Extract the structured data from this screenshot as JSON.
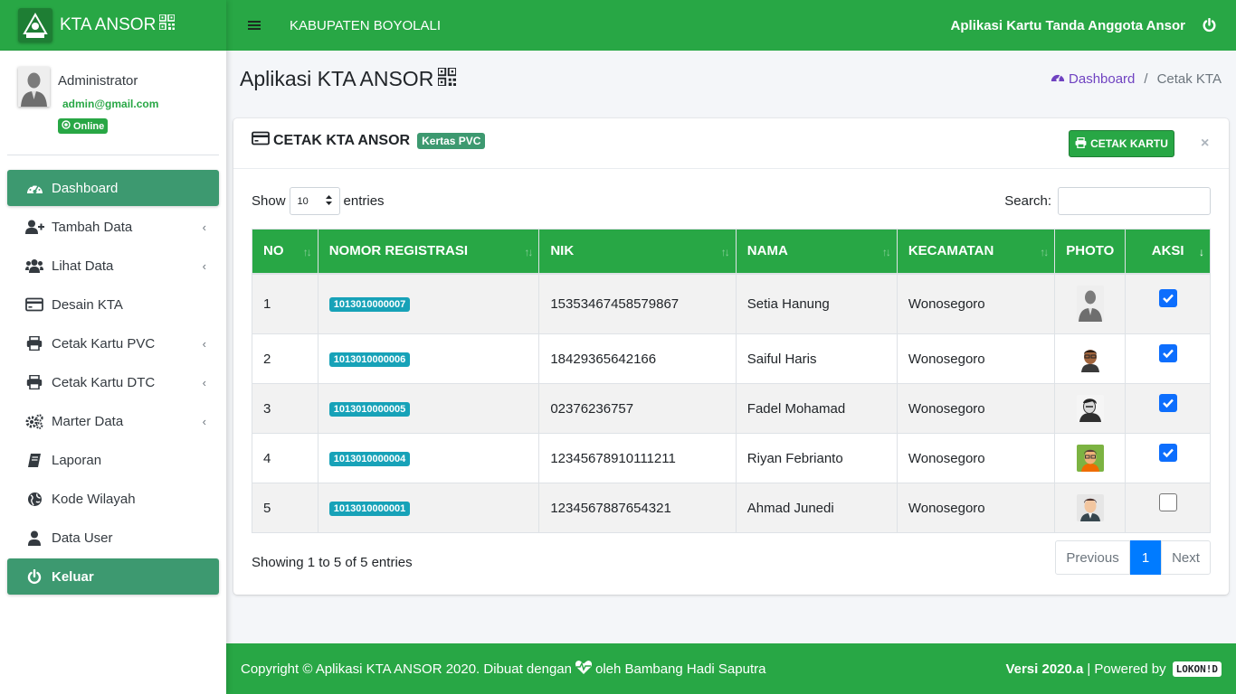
{
  "brand": {
    "title": "KTA ANSOR",
    "logo_text": "ANSOR"
  },
  "topbar": {
    "title": "KABUPATEN BOYOLALI",
    "app_name": "Aplikasi Kartu Tanda Anggota Ansor"
  },
  "user": {
    "name": "Administrator",
    "email": "admin@gmail.com",
    "status": "Online"
  },
  "sidebar": {
    "items": [
      {
        "label": "Dashboard",
        "icon": "tachometer-icon"
      },
      {
        "label": "Tambah Data",
        "icon": "user-plus-icon"
      },
      {
        "label": "Lihat Data",
        "icon": "users-icon"
      },
      {
        "label": "Desain KTA",
        "icon": "credit-card-icon"
      },
      {
        "label": "Cetak Kartu PVC",
        "icon": "printer-icon"
      },
      {
        "label": "Cetak Kartu DTC",
        "icon": "printer-icon"
      },
      {
        "label": "Marter Data",
        "icon": "gears-icon"
      },
      {
        "label": "Laporan",
        "icon": "book-icon"
      },
      {
        "label": "Kode Wilayah",
        "icon": "globe-icon"
      },
      {
        "label": "Data User",
        "icon": "user-icon"
      },
      {
        "label": "Keluar",
        "icon": "power-icon"
      }
    ]
  },
  "page": {
    "title": "Aplikasi KTA ANSOR"
  },
  "breadcrumb": {
    "home": "Dashboard",
    "current": "Cetak KTA"
  },
  "card": {
    "title": "CETAK KTA ANSOR",
    "badge": "Kertas PVC",
    "print_button": "CETAK KARTU",
    "close": "×"
  },
  "datatable": {
    "show_label": "Show",
    "entries_label": "entries",
    "page_length": "10",
    "search_label": "Search:",
    "search_value": "",
    "columns": [
      "NO",
      "NOMOR REGISTRASI",
      "NIK",
      "NAMA",
      "KECAMATAN",
      "PHOTO",
      "AKSI"
    ],
    "rows": [
      {
        "no": "1",
        "reg": "1013010000007",
        "nik": "15353467458579867",
        "nama": "Setia Hanung",
        "kecamatan": "Wonosegoro",
        "photo": "default-avatar",
        "checked": true
      },
      {
        "no": "2",
        "reg": "1013010000006",
        "nik": "18429365642166",
        "nama": "Saiful Haris",
        "kecamatan": "Wonosegoro",
        "photo": "avatar-glasses",
        "checked": true
      },
      {
        "no": "3",
        "reg": "1013010000005",
        "nik": "02376236757",
        "nama": "Fadel Mohamad",
        "kecamatan": "Wonosegoro",
        "photo": "avatar-sketch",
        "checked": true
      },
      {
        "no": "4",
        "reg": "1013010000004",
        "nik": "12345678910111211",
        "nama": "Riyan Febrianto",
        "kecamatan": "Wonosegoro",
        "photo": "avatar-green",
        "checked": true
      },
      {
        "no": "5",
        "reg": "1013010000001",
        "nik": "1234567887654321",
        "nama": "Ahmad Junedi",
        "kecamatan": "Wonosegoro",
        "photo": "avatar-suit",
        "checked": false
      }
    ],
    "info": "Showing 1 to 5 of 5 entries",
    "pagination": {
      "previous": "Previous",
      "current": "1",
      "next": "Next"
    }
  },
  "footer": {
    "left_prefix": "Copyright © Aplikasi KTA ANSOR 2020. Dibuat dengan",
    "left_suffix": "oleh Bambang Hadi Saputra",
    "version": "Versi 2020.a",
    "powered": "| Powered by",
    "powered_badge": "LOKON!D"
  },
  "colors": {
    "primary": "#28a745",
    "active": "#3d9970",
    "badge_info": "#17a2b8",
    "link": "#6f42c1",
    "page_blue": "#007bff"
  }
}
